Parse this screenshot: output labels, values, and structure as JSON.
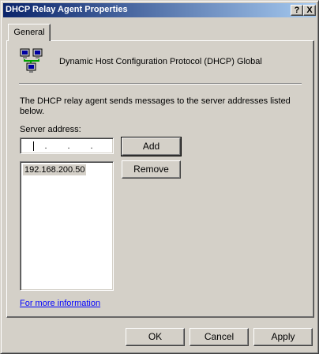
{
  "window": {
    "title": "DHCP Relay Agent Properties"
  },
  "titlebar": {
    "help_label": "?",
    "close_label": "X"
  },
  "tabs": [
    {
      "label": "General"
    }
  ],
  "general": {
    "heading": "Dynamic Host Configuration Protocol (DHCP) Global",
    "description": "The DHCP relay agent sends messages to the server addresses listed below.",
    "server_address_label": "Server address:",
    "server_address_value": "",
    "add_label": "Add",
    "remove_label": "Remove",
    "servers": [
      "192.168.200.50"
    ],
    "more_info_link": "For more information"
  },
  "footer": {
    "ok_label": "OK",
    "cancel_label": "Cancel",
    "apply_label": "Apply"
  },
  "icons": {
    "app": "network-computers-icon"
  },
  "colors": {
    "title_start": "#0a246a",
    "title_end": "#a6caf0",
    "face": "#d4d0c8",
    "link": "#0000ff"
  }
}
